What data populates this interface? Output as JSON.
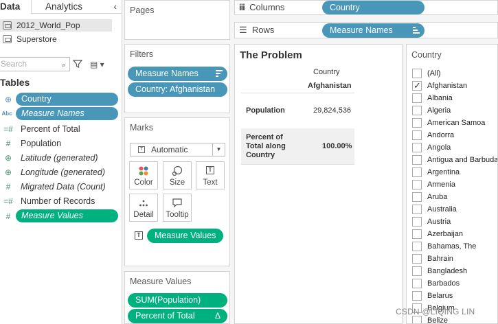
{
  "data_pane": {
    "tabs": [
      "Data",
      "Analytics"
    ],
    "collapse_icon": "chevron-left-icon",
    "data_sources": [
      {
        "name": "2012_World_Pop",
        "selected": true
      },
      {
        "name": "Superstore",
        "selected": false
      }
    ],
    "search_placeholder": "Search",
    "tables_title": "Tables",
    "fields": [
      {
        "name": "Country",
        "icon": "globe-icon",
        "pill": "blue",
        "italic": false
      },
      {
        "name": "Measure Names",
        "icon": "abc-icon",
        "pill": "blue",
        "italic": true
      },
      {
        "name": "Percent of Total",
        "icon": "calc-measure-icon",
        "pill": "",
        "italic": false
      },
      {
        "name": "Population",
        "icon": "measure-icon",
        "pill": "",
        "italic": false
      },
      {
        "name": "Latitude (generated)",
        "icon": "globe-icon",
        "pill": "",
        "italic": true
      },
      {
        "name": "Longitude (generated)",
        "icon": "globe-icon",
        "pill": "",
        "italic": true
      },
      {
        "name": "Migrated Data (Count)",
        "icon": "measure-icon",
        "pill": "",
        "italic": true
      },
      {
        "name": "Number of Records",
        "icon": "calc-measure-icon",
        "pill": "",
        "italic": false
      },
      {
        "name": "Measure Values",
        "icon": "measure-icon",
        "pill": "green",
        "italic": true
      }
    ]
  },
  "pages": {
    "title": "Pages"
  },
  "filters": {
    "title": "Filters",
    "pills": [
      "Measure Names",
      "Country: Afghanistan"
    ]
  },
  "marks": {
    "title": "Marks",
    "type": "Automatic",
    "buttons": [
      "Color",
      "Size",
      "Text",
      "Detail",
      "Tooltip"
    ],
    "pill": "Measure Values"
  },
  "measure_values": {
    "title": "Measure Values",
    "pills": [
      "SUM(Population)",
      "Percent of Total"
    ],
    "delta_symbol": "Δ"
  },
  "columns": {
    "label": "Columns",
    "pill": "Country"
  },
  "rows": {
    "label": "Rows",
    "pill": "Measure Names"
  },
  "view": {
    "title": "The Problem",
    "header_field": "Country",
    "header_value": "Afghanistan",
    "rows": [
      {
        "label": "Population",
        "value": "29,824,536"
      },
      {
        "label_lines": [
          "Percent of",
          "Total along",
          "Country"
        ],
        "value": "100.00%"
      }
    ]
  },
  "country_filter": {
    "title": "Country",
    "items": [
      {
        "label": "(All)",
        "checked": false
      },
      {
        "label": "Afghanistan",
        "checked": true
      },
      {
        "label": "Albania",
        "checked": false
      },
      {
        "label": "Algeria",
        "checked": false
      },
      {
        "label": "American Samoa",
        "checked": false
      },
      {
        "label": "Andorra",
        "checked": false
      },
      {
        "label": "Angola",
        "checked": false
      },
      {
        "label": "Antigua and Barbuda",
        "checked": false
      },
      {
        "label": "Argentina",
        "checked": false
      },
      {
        "label": "Armenia",
        "checked": false
      },
      {
        "label": "Aruba",
        "checked": false
      },
      {
        "label": "Australia",
        "checked": false
      },
      {
        "label": "Austria",
        "checked": false
      },
      {
        "label": "Azerbaijan",
        "checked": false
      },
      {
        "label": "Bahamas, The",
        "checked": false
      },
      {
        "label": "Bahrain",
        "checked": false
      },
      {
        "label": "Bangladesh",
        "checked": false
      },
      {
        "label": "Barbados",
        "checked": false
      },
      {
        "label": "Belarus",
        "checked": false
      },
      {
        "label": "Belgium",
        "checked": false
      },
      {
        "label": "Belize",
        "checked": false
      }
    ]
  },
  "watermark": "CSDN @LIQING LIN",
  "colors": {
    "pill_blue": "#4896b8",
    "pill_green": "#00b180"
  }
}
